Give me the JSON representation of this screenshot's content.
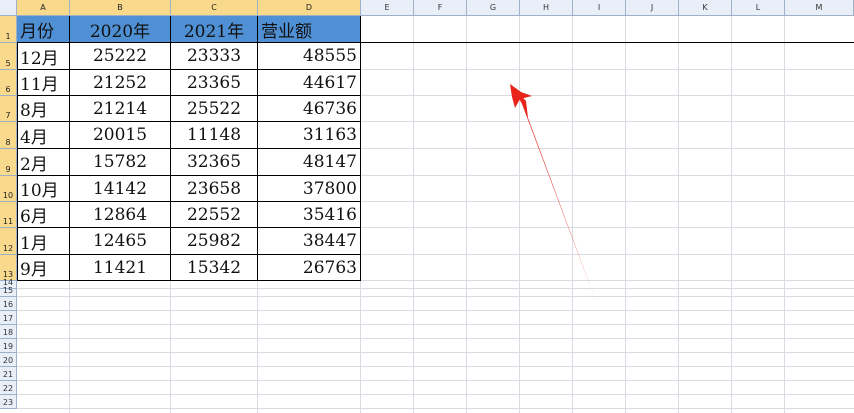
{
  "columns": [
    "A",
    "B",
    "C",
    "D",
    "E",
    "F",
    "G",
    "H",
    "I",
    "J",
    "K",
    "L",
    "M"
  ],
  "row_numbers": [
    "1",
    "5",
    "6",
    "7",
    "8",
    "9",
    "10",
    "11",
    "12",
    "13",
    "14",
    "15",
    "16",
    "17",
    "18",
    "19",
    "20",
    "21",
    "22",
    "23"
  ],
  "table": {
    "headers": [
      "月份",
      "2020年",
      "2021年",
      "营业额"
    ],
    "rows": [
      [
        "12月",
        "25222",
        "23333",
        "48555"
      ],
      [
        "11月",
        "21252",
        "23365",
        "44617"
      ],
      [
        "8月",
        "21214",
        "25522",
        "46736"
      ],
      [
        "4月",
        "20015",
        "11148",
        "31163"
      ],
      [
        "2月",
        "15782",
        "32365",
        "48147"
      ],
      [
        "10月",
        "14142",
        "23658",
        "37800"
      ],
      [
        "6月",
        "12864",
        "22552",
        "35416"
      ],
      [
        "1月",
        "12465",
        "25982",
        "38447"
      ],
      [
        "9月",
        "11421",
        "15342",
        "26763"
      ]
    ]
  },
  "colors": {
    "header_fill": "#4f8fd4",
    "selected_header": "#f9d98c",
    "arrow": "#e8241b"
  },
  "annotation": {
    "icon": "red-arrow-icon"
  }
}
